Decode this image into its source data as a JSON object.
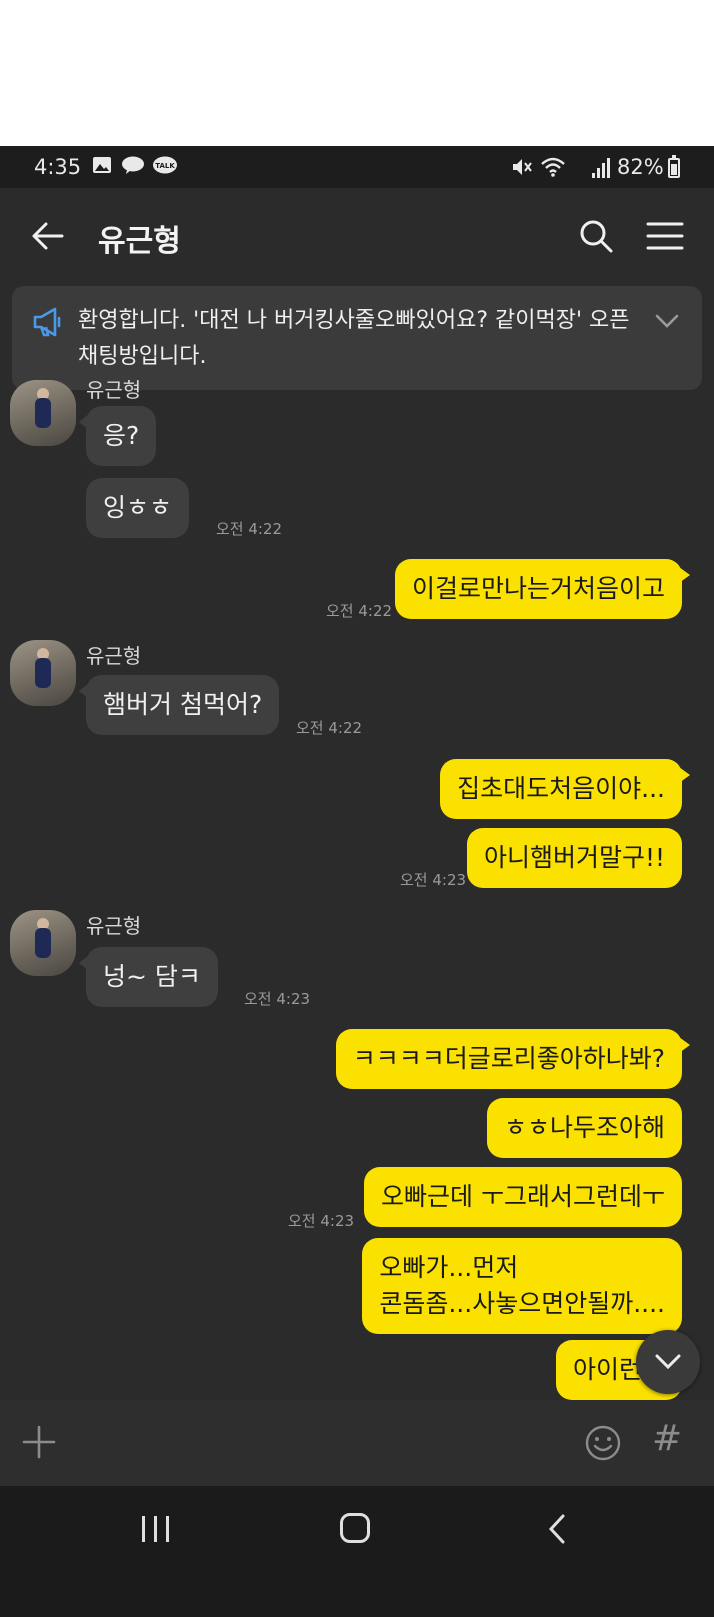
{
  "status_bar": {
    "time": "4:35",
    "battery": "82%",
    "left_icons": [
      "image-icon",
      "chat-bubble-icon",
      "talk-icon"
    ],
    "right_icons": [
      "mute-icon",
      "wifi-icon",
      "signal-icon",
      "battery-icon"
    ]
  },
  "header": {
    "title": "유근형",
    "icons": [
      "back-arrow-icon",
      "search-icon",
      "menu-icon"
    ]
  },
  "notice": {
    "text": "환영합니다. '대전 나 버거킹사줄오빠있어요? 같이먹장' 오픈채팅방입니다.",
    "icons": [
      "megaphone-icon",
      "chevron-down-icon"
    ]
  },
  "messages": [
    {
      "side": "in",
      "sender": "유근형",
      "text": "응?"
    },
    {
      "side": "in",
      "text": "잉ㅎㅎ",
      "time": "오전 4:22"
    },
    {
      "side": "out",
      "text": "이걸로만나는거처음이고",
      "time": "오전 4:22"
    },
    {
      "side": "in",
      "sender": "유근형",
      "text": "햄버거 첨먹어?",
      "time": "오전 4:22"
    },
    {
      "side": "out",
      "text": "집초대도처음이야...",
      "time": ""
    },
    {
      "side": "out",
      "text": "아니햄버거말구!!",
      "time": "오전 4:23"
    },
    {
      "side": "in",
      "sender": "유근형",
      "text": "넝~ 담ㅋ",
      "time": "오전 4:23"
    },
    {
      "side": "out",
      "text": "ㅋㅋㅋㅋ더글로리좋아하나봐?",
      "time": ""
    },
    {
      "side": "out",
      "text": "ㅎㅎ나두조아해",
      "time": ""
    },
    {
      "side": "out",
      "text": "오빠근데 ㅜ그래서그런데ㅜ",
      "time": "오전 4:23"
    },
    {
      "side": "out",
      "line1": "오빠가...먼저",
      "line2": "콘돔좀...사놓으면안될까...."
    },
    {
      "side": "out",
      "text": "아이런말"
    }
  ],
  "input_bar": {
    "icons": [
      "plus-icon",
      "emoji-icon",
      "hash-icon"
    ],
    "hash": "#"
  },
  "nav_bar": {
    "icons": [
      "recent-apps-icon",
      "home-icon",
      "back-icon"
    ]
  },
  "colors": {
    "chat_background": "#2b2b2b",
    "incoming_bubble": "#3f3f3f",
    "outgoing_bubble": "#fae100",
    "timestamp": "#9a9a9a"
  }
}
